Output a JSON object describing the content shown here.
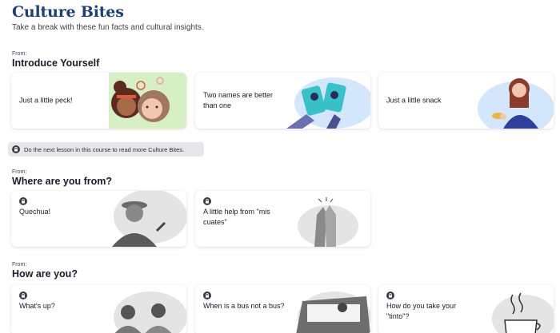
{
  "header": {
    "title": "Culture Bites",
    "subtitle": "Take a break with these fun facts and cultural insights."
  },
  "sections": [
    {
      "from": "From:",
      "title": "Introduce Yourself",
      "cards": [
        {
          "label": "Just a little peck!",
          "locked": false
        },
        {
          "label": "Two names are better than one",
          "locked": false
        },
        {
          "label": "Just a little snack",
          "locked": false
        }
      ]
    },
    {
      "from": "From:",
      "title": "Where are you from?",
      "cards": [
        {
          "label": "Quechua!",
          "locked": true
        },
        {
          "label": "A little help from \"mis cuates\"",
          "locked": true
        }
      ]
    },
    {
      "from": "From:",
      "title": "How are you?",
      "cards": [
        {
          "label": "What's up?",
          "locked": true
        },
        {
          "label": "When is a bus not a bus?",
          "locked": true
        },
        {
          "label": "How do you take your \"tinto\"?",
          "locked": true
        }
      ]
    }
  ],
  "banner": {
    "text": "Do the next lesson in this course to read more Culture Bites.",
    "icon": "lock-icon"
  },
  "colors": {
    "title": "#1d3f73",
    "accent_green": "#d6efc4",
    "accent_blue": "#d3e6fb",
    "locked_gray": "#e4e4e4"
  }
}
